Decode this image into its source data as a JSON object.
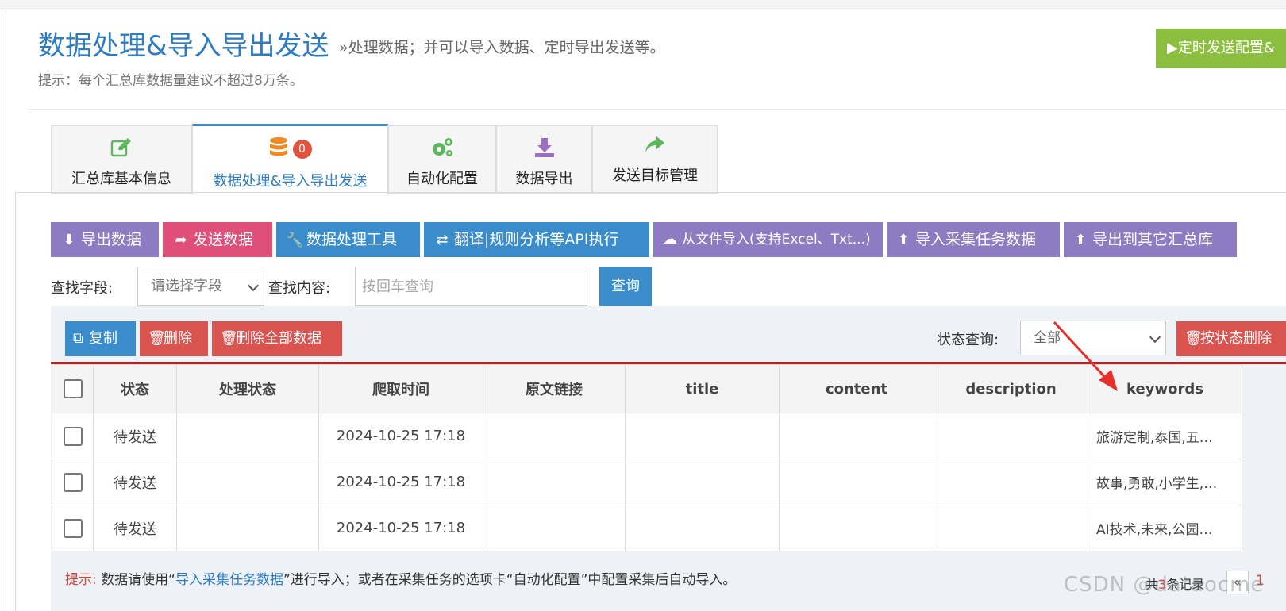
{
  "header": {
    "title": "数据处理&导入导出发送",
    "subtitle": "»处理数据；并可以导入数据、定时导出发送等。",
    "hint": "提示：每个汇总库数据量建议不超过8万条。",
    "scheduled_send_label": "▶定时发送配置&"
  },
  "tabs": [
    {
      "label": "汇总库基本信息",
      "icon": "edit-icon",
      "color": "#5cb85c"
    },
    {
      "label": "数据处理&导入导出发送",
      "icon": "database-icon",
      "color": "#f08a24",
      "badge": "0"
    },
    {
      "label": "自动化配置",
      "icon": "gears-icon",
      "color": "#5cb85c"
    },
    {
      "label": "数据导出",
      "icon": "download-icon",
      "color": "#9b6fc4"
    },
    {
      "label": "发送目标管理",
      "icon": "share-icon",
      "color": "#5cb85c"
    }
  ],
  "toolbar": {
    "export_data": "导出数据",
    "send_data": "发送数据",
    "process_tools": "数据处理工具",
    "translate_api": "翻译|规则分析等API执行",
    "import_file": "从文件导入(支持Excel、Txt...)",
    "import_task": "导入采集任务数据",
    "export_other": "导出到其它汇总库"
  },
  "search": {
    "field_label": "查找字段:",
    "field_select": "请选择字段",
    "content_label": "查找内容:",
    "placeholder": "按回车查询",
    "query_button": "查询"
  },
  "actions": {
    "copy": "复制",
    "delete": "删除",
    "delete_all": "删除全部数据",
    "status_label": "状态查询:",
    "status_value": "全部",
    "delete_by_status": "按状态删除"
  },
  "table": {
    "columns": [
      "状态",
      "处理状态",
      "爬取时间",
      "原文链接",
      "title",
      "content",
      "description",
      "keywords"
    ],
    "rows": [
      {
        "status": "待发送",
        "process": "",
        "time": "2024-10-25 17:18",
        "link": "",
        "title": "",
        "content": "",
        "description": "",
        "keywords": "旅游定制,泰国,五…"
      },
      {
        "status": "待发送",
        "process": "",
        "time": "2024-10-25 17:18",
        "link": "",
        "title": "",
        "content": "",
        "description": "",
        "keywords": "故事,勇敢,小学生,…"
      },
      {
        "status": "待发送",
        "process": "",
        "time": "2024-10-25 17:18",
        "link": "",
        "title": "",
        "content": "",
        "description": "",
        "keywords": "AI技术,未来,公园…"
      }
    ]
  },
  "footer": {
    "hint_prefix": "提示:",
    "hint_text1": " 数据请使用“",
    "hint_link": "导入采集任务数据",
    "hint_text2": "”进行导入；或者在采集任务的选项卡“自动化配置”中配置采集后自动导入。",
    "records_prefix": "共",
    "records_count": "3",
    "records_suffix": "条记录",
    "prev": "«",
    "page": "1"
  },
  "watermark": "CSDN @dataocme",
  "colors": {
    "primary": "#3a8ccb",
    "purple": "#8e7cc3",
    "pink": "#e04e7a",
    "red": "#d9534f",
    "green": "#8cbf3f",
    "title_blue": "#2c7bc3"
  }
}
